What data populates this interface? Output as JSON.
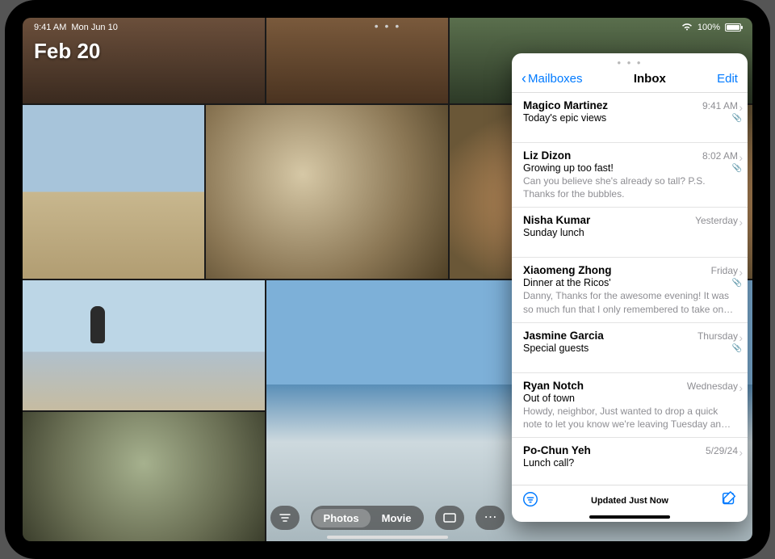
{
  "status_bar": {
    "time": "9:41 AM",
    "date": "Mon Jun 10",
    "battery_pct": "100%"
  },
  "photos": {
    "current_date": "Feb 20",
    "segmented": {
      "photos": "Photos",
      "movie": "Movie"
    }
  },
  "mail": {
    "back_label": "Mailboxes",
    "title": "Inbox",
    "edit_label": "Edit",
    "footer_status": "Updated Just Now",
    "messages": [
      {
        "sender": "Magico Martinez",
        "time": "9:41 AM",
        "subject": "Today's epic views",
        "preview": "",
        "has_attachment": true
      },
      {
        "sender": "Liz Dizon",
        "time": "8:02 AM",
        "subject": "Growing up too fast!",
        "preview": "Can you believe she's already so tall? P.S. Thanks for the bubbles.",
        "has_attachment": true
      },
      {
        "sender": "Nisha Kumar",
        "time": "Yesterday",
        "subject": "Sunday lunch",
        "preview": "",
        "has_attachment": false
      },
      {
        "sender": "Xiaomeng Zhong",
        "time": "Friday",
        "subject": "Dinner at the Ricos'",
        "preview": "Danny, Thanks for the awesome evening! It was so much fun that I only remembered to take on…",
        "has_attachment": true
      },
      {
        "sender": "Jasmine Garcia",
        "time": "Thursday",
        "subject": "Special guests",
        "preview": "",
        "has_attachment": true
      },
      {
        "sender": "Ryan Notch",
        "time": "Wednesday",
        "subject": "Out of town",
        "preview": "Howdy, neighbor, Just wanted to drop a quick note to let you know we're leaving Tuesday an…",
        "has_attachment": false
      },
      {
        "sender": "Po-Chun Yeh",
        "time": "5/29/24",
        "subject": "Lunch call?",
        "preview": "",
        "has_attachment": false
      }
    ]
  }
}
